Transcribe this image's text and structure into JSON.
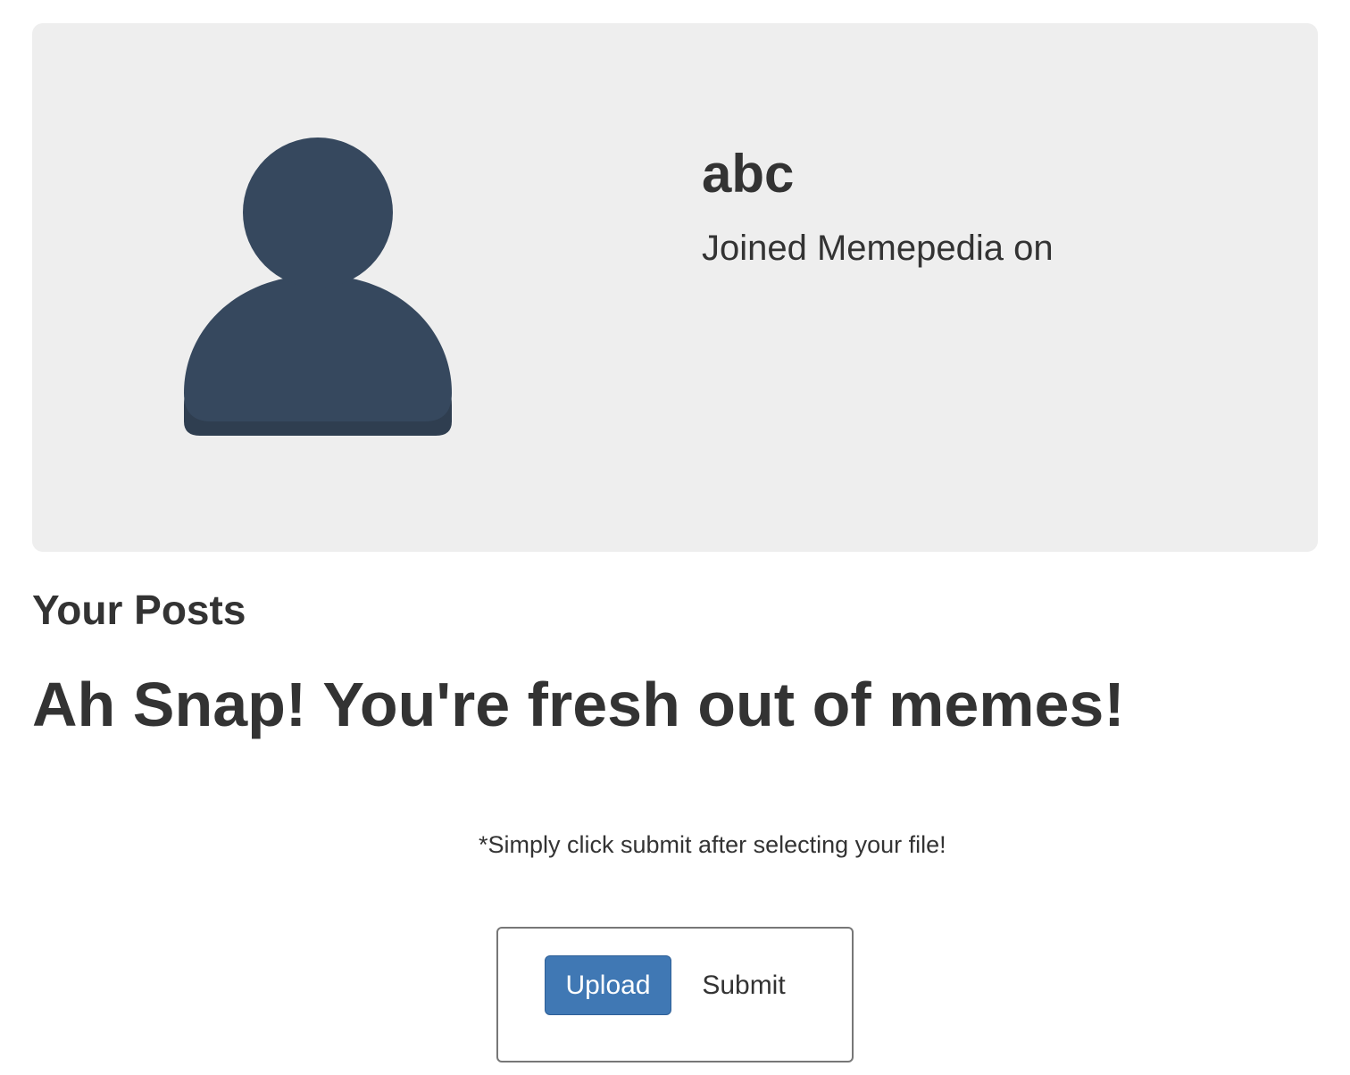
{
  "profile": {
    "username": "abc",
    "joined_text": "Joined Memepedia on",
    "avatar_icon": "user-silhouette-icon",
    "avatar_color": "#36485e",
    "card_background": "#eeeeee"
  },
  "posts": {
    "heading": "Your Posts",
    "empty_message": "Ah Snap! You're fresh out of memes!"
  },
  "upload": {
    "help_text": "*Simply click submit after selecting your file!",
    "upload_label": "Upload",
    "submit_label": "Submit",
    "upload_color": "#4078b4"
  }
}
